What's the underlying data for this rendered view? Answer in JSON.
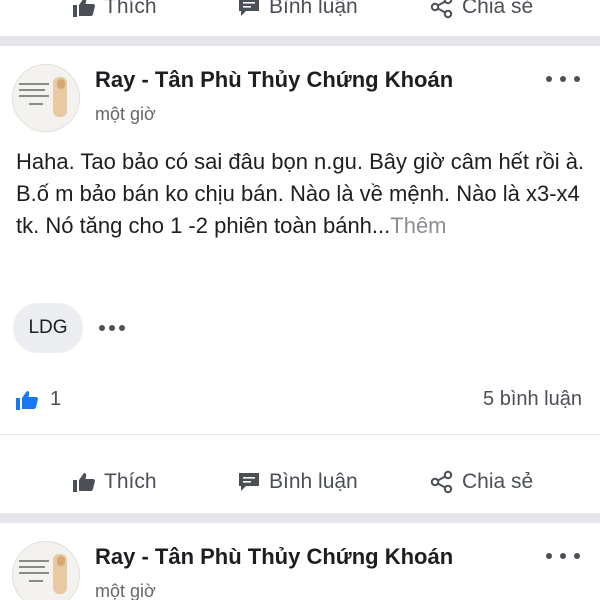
{
  "top_actions": {
    "like_label": "Thích",
    "comment_label": "Bình luận",
    "share_label": "Chia sẻ"
  },
  "post1": {
    "author": "Ray - Tân Phù Thủy Chứng Khoán",
    "time": "một giờ",
    "body": "Haha. Tao bảo có sai đâu bọn n.gu. Bây giờ câm hết rồi à. B.ố m bảo bán ko chịu bán. Nào là về mệnh. Nào là x3-x4 tk. Nó tăng cho 1 -2 phiên toàn bánh...",
    "see_more": "Thêm",
    "tag": "LDG",
    "like_count": "1",
    "comment_count": "5 bình luận",
    "actions": {
      "like_label": "Thích",
      "comment_label": "Bình luận",
      "share_label": "Chia sẻ"
    }
  },
  "post2": {
    "author": "Ray - Tân Phù Thủy Chứng Khoán",
    "time": "một giờ"
  },
  "colors": {
    "icon": "#4b4f56",
    "like_blue": "#1877f2",
    "divider": "#e4e6eb",
    "muted_text": "#65676b"
  },
  "icons": {
    "like": "thumbs-up-icon",
    "comment": "comment-icon",
    "share": "share-icon",
    "more": "more-dots-icon"
  }
}
